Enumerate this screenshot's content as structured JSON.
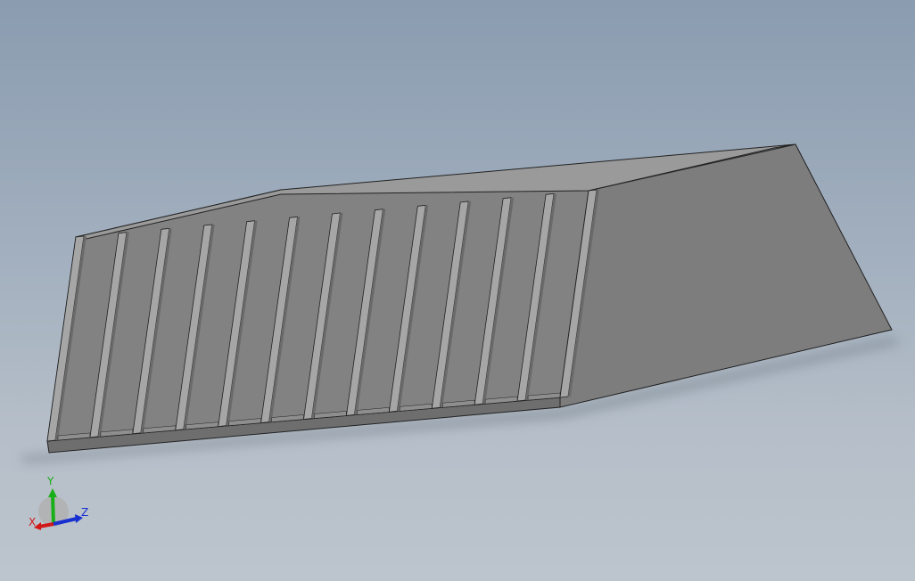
{
  "viewport": {
    "background_top": "#8a9cb0",
    "background_bottom": "#bcc4cd"
  },
  "model": {
    "slat_count": 12,
    "colors": {
      "front_face": "#828282",
      "side_face": "#7d7d7d",
      "top_edge": "#9a9a9a",
      "edge_line": "#222222",
      "base_plate": "#6e6e6e",
      "slat_highlight": "#a6a6a6",
      "slat_shadow": "#6a6a6a"
    }
  },
  "triad": {
    "x_label": "X",
    "y_label": "Y",
    "z_label": "Z",
    "x_color": "#d01818",
    "y_color": "#18b018",
    "z_color": "#1830d0"
  }
}
